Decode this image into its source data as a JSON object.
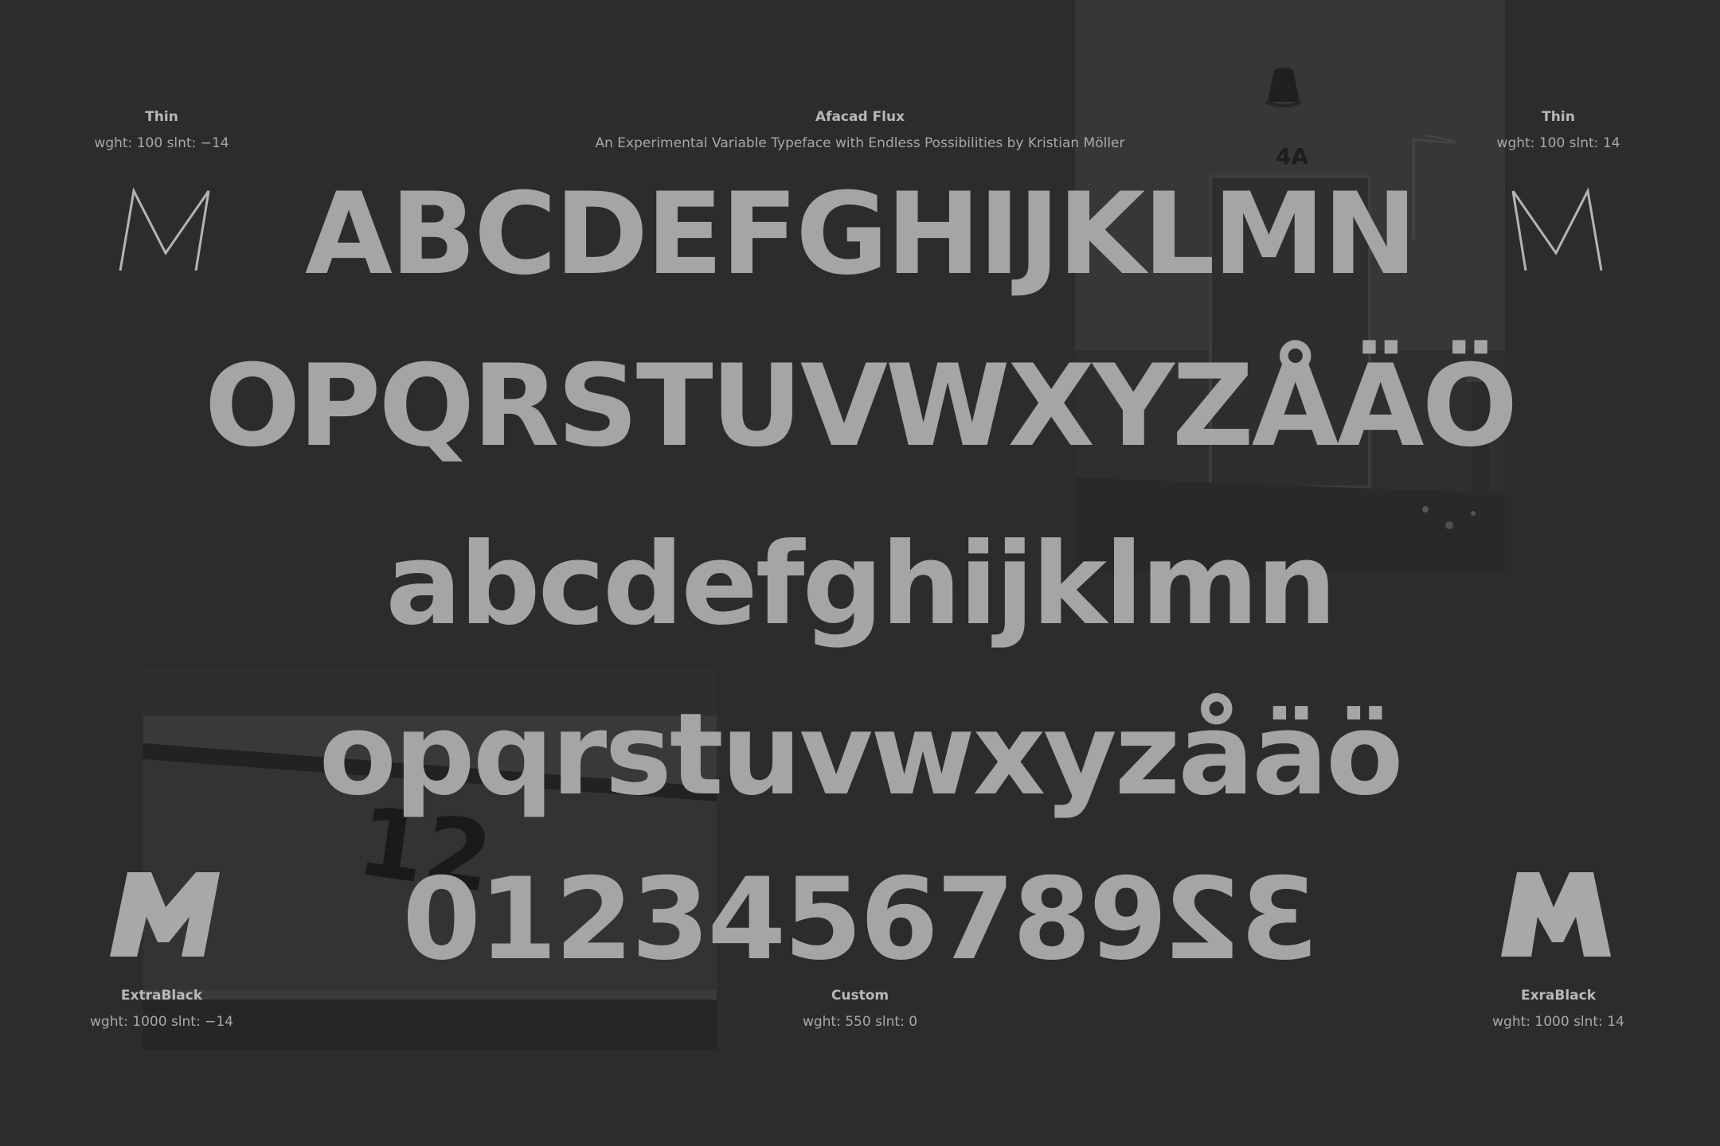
{
  "header": {
    "title": "Afacad Flux",
    "subtitle": "An Experimental Variable Typeface with Endless Possibilities by Kristian Möller"
  },
  "corners": {
    "top_left": {
      "title": "Thin",
      "axes": "wght: 100  slnt: −14",
      "glyph": "M"
    },
    "top_right": {
      "title": "Thin",
      "axes": "wght: 100  slnt: 14",
      "glyph": "M"
    },
    "bottom_left": {
      "title": "ExtraBlack",
      "axes": "wght: 1000  slnt: −14",
      "glyph": "M"
    },
    "bottom_right": {
      "title": "ExraBlack",
      "axes": "wght: 1000  slnt: 14",
      "glyph": "M"
    }
  },
  "custom": {
    "title": "Custom",
    "axes": "wght: 550  slnt: 0"
  },
  "specimen": {
    "uppercase_1": "ABCDEFGHIJKLMN",
    "uppercase_2": "OPQRSTUVWXYZÅÄÖ",
    "lowercase_1": "abcdefghijklmn",
    "lowercase_2": "opqrstuvwxyzåäö",
    "digits_main": "012345678",
    "digits_flipped": "9",
    "digits_tail_mirrored_2": "2",
    "digits_tail_mirrored_3": "3"
  },
  "photos": {
    "door_number": "4A",
    "wall_number": "12"
  },
  "colors": {
    "background": "#2c2c2c",
    "type": "#a6a5a5",
    "label": "#b9b8b8"
  }
}
